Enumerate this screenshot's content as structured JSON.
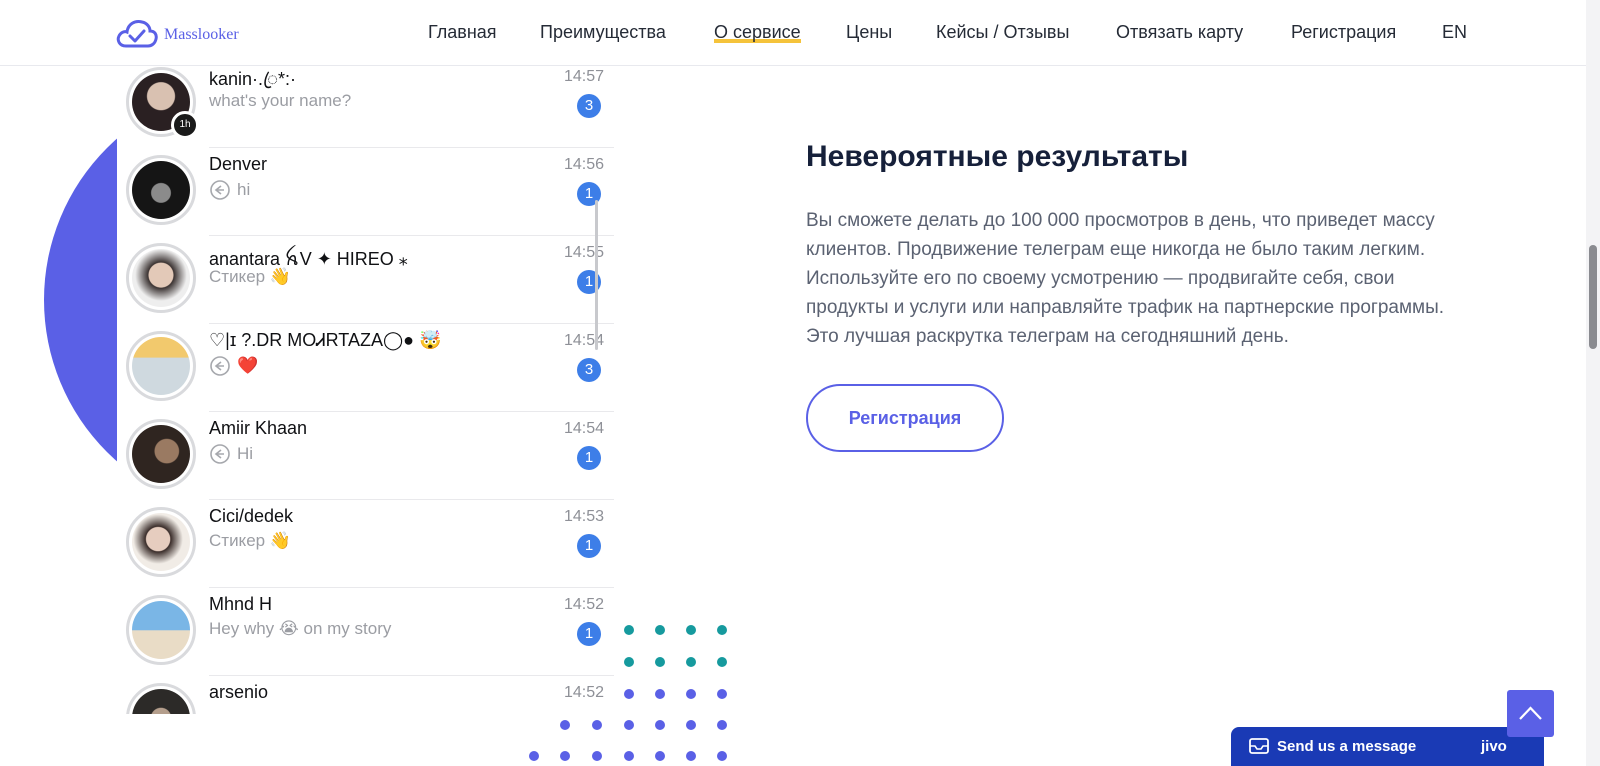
{
  "brand": {
    "name": "Masslooker",
    "color": "#5a60e6"
  },
  "nav": {
    "items": [
      {
        "label": "Главная"
      },
      {
        "label": "Преимущества"
      },
      {
        "label": "О сервисе",
        "active": true
      },
      {
        "label": "Цены"
      },
      {
        "label": "Кейсы / Отзывы"
      },
      {
        "label": "Отвязать карту"
      },
      {
        "label": "Регистрация"
      },
      {
        "label": "EN"
      }
    ]
  },
  "chats": [
    {
      "name": "kanin·.ꦿ*:·",
      "time": "14:57",
      "preview": "what's your name?",
      "reply_icon": false,
      "unread": "3",
      "story_badge": "1h"
    },
    {
      "name": "Denver",
      "time": "14:56",
      "preview": "hi",
      "reply_icon": true,
      "unread": "1"
    },
    {
      "name": "anantara ꫝV ✦ HIREO ⁎",
      "time": "14:55",
      "preview": "Стикер 👋",
      "reply_icon": false,
      "unread": "1"
    },
    {
      "name": "♡|ɪ ?.DR MOᏗRTAZA◯● 🤯",
      "time": "14:54",
      "preview": "❤️",
      "reply_icon": true,
      "unread": "3"
    },
    {
      "name": "Amiir Khaan",
      "time": "14:54",
      "preview": "Hi",
      "reply_icon": true,
      "unread": "1"
    },
    {
      "name": "Cici/dedek",
      "time": "14:53",
      "preview": "Стикер 👋",
      "reply_icon": false,
      "unread": "1"
    },
    {
      "name": "Mhnd H",
      "time": "14:52",
      "preview": "Hey why 😭 on my story",
      "reply_icon": false,
      "unread": "1"
    },
    {
      "name": "arsenio",
      "time": "14:52",
      "preview": "",
      "reply_icon": false,
      "unread": ""
    }
  ],
  "content": {
    "heading": "Невероятные результаты",
    "paragraph": "Вы сможете делать до 100 000 просмотров в день, что приведет массу клиентов. Продвижение телеграм еще никогда не было таким легким. Используйте его по своему усмотрению — продвигайте себя, свои продукты и услуги или направляйте трафик на партнерские программы. Это лучшая раскрутка телеграм на сегодняшний день.",
    "button_label": "Регистрация"
  },
  "chat_widget": {
    "label": "Send us a message",
    "brand": "jivo"
  },
  "colors": {
    "accent": "#5a60e6",
    "teal": "#169a9e",
    "badge": "#3d7ee8",
    "underline": "#f5c33b",
    "widget": "#1a3ab5"
  },
  "icons": {
    "logo": "cloud-check-icon",
    "reply": "reply-arrow-icon",
    "mail": "mail-icon",
    "scroll_top": "chevron-up-icon"
  }
}
